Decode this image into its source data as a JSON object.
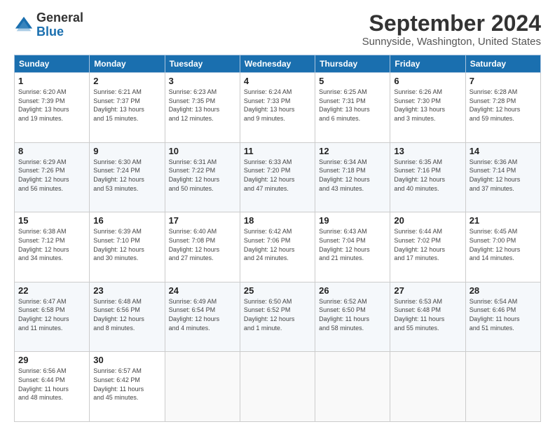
{
  "logo": {
    "general": "General",
    "blue": "Blue"
  },
  "title": "September 2024",
  "location": "Sunnyside, Washington, United States",
  "days_header": [
    "Sunday",
    "Monday",
    "Tuesday",
    "Wednesday",
    "Thursday",
    "Friday",
    "Saturday"
  ],
  "weeks": [
    [
      {
        "day": "1",
        "info": "Sunrise: 6:20 AM\nSunset: 7:39 PM\nDaylight: 13 hours\nand 19 minutes."
      },
      {
        "day": "2",
        "info": "Sunrise: 6:21 AM\nSunset: 7:37 PM\nDaylight: 13 hours\nand 15 minutes."
      },
      {
        "day": "3",
        "info": "Sunrise: 6:23 AM\nSunset: 7:35 PM\nDaylight: 13 hours\nand 12 minutes."
      },
      {
        "day": "4",
        "info": "Sunrise: 6:24 AM\nSunset: 7:33 PM\nDaylight: 13 hours\nand 9 minutes."
      },
      {
        "day": "5",
        "info": "Sunrise: 6:25 AM\nSunset: 7:31 PM\nDaylight: 13 hours\nand 6 minutes."
      },
      {
        "day": "6",
        "info": "Sunrise: 6:26 AM\nSunset: 7:30 PM\nDaylight: 13 hours\nand 3 minutes."
      },
      {
        "day": "7",
        "info": "Sunrise: 6:28 AM\nSunset: 7:28 PM\nDaylight: 12 hours\nand 59 minutes."
      }
    ],
    [
      {
        "day": "8",
        "info": "Sunrise: 6:29 AM\nSunset: 7:26 PM\nDaylight: 12 hours\nand 56 minutes."
      },
      {
        "day": "9",
        "info": "Sunrise: 6:30 AM\nSunset: 7:24 PM\nDaylight: 12 hours\nand 53 minutes."
      },
      {
        "day": "10",
        "info": "Sunrise: 6:31 AM\nSunset: 7:22 PM\nDaylight: 12 hours\nand 50 minutes."
      },
      {
        "day": "11",
        "info": "Sunrise: 6:33 AM\nSunset: 7:20 PM\nDaylight: 12 hours\nand 47 minutes."
      },
      {
        "day": "12",
        "info": "Sunrise: 6:34 AM\nSunset: 7:18 PM\nDaylight: 12 hours\nand 43 minutes."
      },
      {
        "day": "13",
        "info": "Sunrise: 6:35 AM\nSunset: 7:16 PM\nDaylight: 12 hours\nand 40 minutes."
      },
      {
        "day": "14",
        "info": "Sunrise: 6:36 AM\nSunset: 7:14 PM\nDaylight: 12 hours\nand 37 minutes."
      }
    ],
    [
      {
        "day": "15",
        "info": "Sunrise: 6:38 AM\nSunset: 7:12 PM\nDaylight: 12 hours\nand 34 minutes."
      },
      {
        "day": "16",
        "info": "Sunrise: 6:39 AM\nSunset: 7:10 PM\nDaylight: 12 hours\nand 30 minutes."
      },
      {
        "day": "17",
        "info": "Sunrise: 6:40 AM\nSunset: 7:08 PM\nDaylight: 12 hours\nand 27 minutes."
      },
      {
        "day": "18",
        "info": "Sunrise: 6:42 AM\nSunset: 7:06 PM\nDaylight: 12 hours\nand 24 minutes."
      },
      {
        "day": "19",
        "info": "Sunrise: 6:43 AM\nSunset: 7:04 PM\nDaylight: 12 hours\nand 21 minutes."
      },
      {
        "day": "20",
        "info": "Sunrise: 6:44 AM\nSunset: 7:02 PM\nDaylight: 12 hours\nand 17 minutes."
      },
      {
        "day": "21",
        "info": "Sunrise: 6:45 AM\nSunset: 7:00 PM\nDaylight: 12 hours\nand 14 minutes."
      }
    ],
    [
      {
        "day": "22",
        "info": "Sunrise: 6:47 AM\nSunset: 6:58 PM\nDaylight: 12 hours\nand 11 minutes."
      },
      {
        "day": "23",
        "info": "Sunrise: 6:48 AM\nSunset: 6:56 PM\nDaylight: 12 hours\nand 8 minutes."
      },
      {
        "day": "24",
        "info": "Sunrise: 6:49 AM\nSunset: 6:54 PM\nDaylight: 12 hours\nand 4 minutes."
      },
      {
        "day": "25",
        "info": "Sunrise: 6:50 AM\nSunset: 6:52 PM\nDaylight: 12 hours\nand 1 minute."
      },
      {
        "day": "26",
        "info": "Sunrise: 6:52 AM\nSunset: 6:50 PM\nDaylight: 11 hours\nand 58 minutes."
      },
      {
        "day": "27",
        "info": "Sunrise: 6:53 AM\nSunset: 6:48 PM\nDaylight: 11 hours\nand 55 minutes."
      },
      {
        "day": "28",
        "info": "Sunrise: 6:54 AM\nSunset: 6:46 PM\nDaylight: 11 hours\nand 51 minutes."
      }
    ],
    [
      {
        "day": "29",
        "info": "Sunrise: 6:56 AM\nSunset: 6:44 PM\nDaylight: 11 hours\nand 48 minutes."
      },
      {
        "day": "30",
        "info": "Sunrise: 6:57 AM\nSunset: 6:42 PM\nDaylight: 11 hours\nand 45 minutes."
      },
      {
        "day": "",
        "info": ""
      },
      {
        "day": "",
        "info": ""
      },
      {
        "day": "",
        "info": ""
      },
      {
        "day": "",
        "info": ""
      },
      {
        "day": "",
        "info": ""
      }
    ]
  ]
}
